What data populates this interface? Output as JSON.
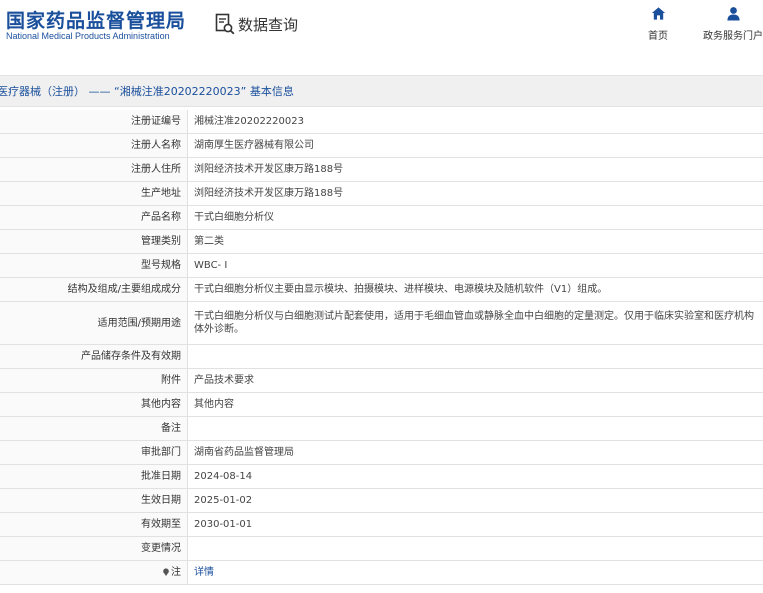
{
  "header": {
    "logo_cn": "国家药品监督管理局",
    "logo_en": "National Medical Products Administration",
    "query_label": "数据查询",
    "nav": [
      {
        "label": "首页",
        "icon": "home-icon"
      },
      {
        "label": "政务服务门户",
        "icon": "user-icon"
      }
    ]
  },
  "title": "医疗器械（注册） —— “湘械注准20202220023” 基本信息",
  "rows": [
    {
      "label": "注册证编号",
      "value": "湘械注准20202220023"
    },
    {
      "label": "注册人名称",
      "value": "湖南厚生医疗器械有限公司"
    },
    {
      "label": "注册人住所",
      "value": "浏阳经济技术开发区康万路188号"
    },
    {
      "label": "生产地址",
      "value": "浏阳经济技术开发区康万路188号"
    },
    {
      "label": "产品名称",
      "value": "干式白细胞分析仪"
    },
    {
      "label": "管理类别",
      "value": "第二类"
    },
    {
      "label": "型号规格",
      "value": "WBC- I"
    },
    {
      "label": "结构及组成/主要组成成分",
      "value": "干式白细胞分析仪主要由显示模块、拍摄模块、进样模块、电源模块及随机软件（V1）组成。"
    },
    {
      "label": "适用范围/预期用途",
      "value": "干式白细胞分析仪与白细胞测试片配套使用，适用于毛细血管血或静脉全血中白细胞的定量测定。仅用于临床实验室和医疗机构体外诊断。"
    },
    {
      "label": "产品储存条件及有效期",
      "value": ""
    },
    {
      "label": "附件",
      "value": "产品技术要求"
    },
    {
      "label": "其他内容",
      "value": "其他内容"
    },
    {
      "label": "备注",
      "value": ""
    },
    {
      "label": "审批部门",
      "value": "湖南省药品监督管理局"
    },
    {
      "label": "批准日期",
      "value": "2024-08-14"
    },
    {
      "label": "生效日期",
      "value": "2025-01-02"
    },
    {
      "label": "有效期至",
      "value": "2030-01-01"
    },
    {
      "label": "变更情况",
      "value": ""
    },
    {
      "label": "注",
      "value": "详情",
      "icon": "pin-icon"
    }
  ]
}
